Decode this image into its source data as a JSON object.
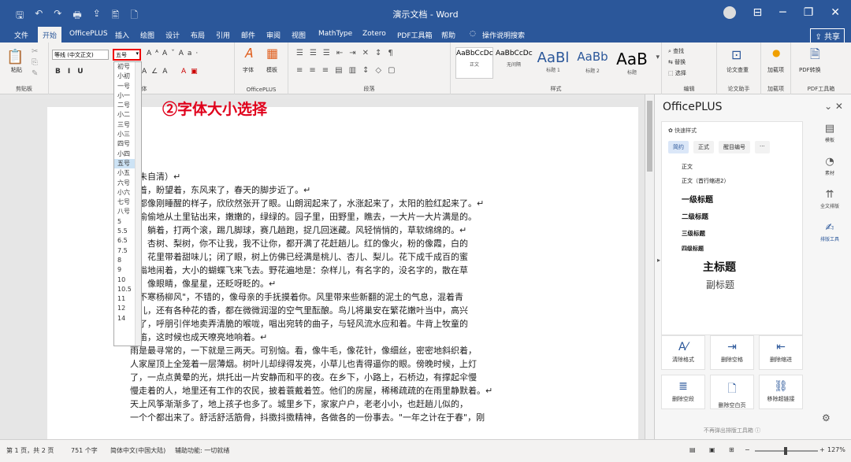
{
  "title": "演示文档 - Word",
  "qat": [
    "🖫",
    "↶",
    "↷",
    "🖶",
    "⇪",
    "🖺",
    "🗋"
  ],
  "tabs": [
    "文件",
    "开始",
    "OfficePLUS",
    "插入",
    "绘图",
    "设计",
    "布局",
    "引用",
    "邮件",
    "审阅",
    "视图",
    "MathType",
    "Zotero",
    "PDF工具箱",
    "帮助",
    "操作说明搜索"
  ],
  "share": "共享",
  "ribbon": {
    "paste": "粘贴",
    "clipboard": "剪贴板",
    "font_name": "等线 (中文正文)",
    "font_size": "五号",
    "font_group": "字体",
    "officeplus_btns": [
      "字体",
      "模板"
    ],
    "officeplus_group": "OfficePLUS",
    "paragraph_group": "段落",
    "styles": [
      {
        "sample": "AaBbCcDc",
        "label": "正文",
        "size": "9"
      },
      {
        "sample": "AaBbCcDc",
        "label": "无间隔",
        "size": "9"
      },
      {
        "sample": "AaBl",
        "label": "标题 1",
        "size": "18"
      },
      {
        "sample": "AaBb",
        "label": "标题 2",
        "size": "15"
      },
      {
        "sample": "AaB",
        "label": "标题",
        "size": "20"
      }
    ],
    "styles_group": "样式",
    "edit": [
      "查找",
      "替换",
      "选择"
    ],
    "edit_group": "编辑",
    "paper_check": "论文查重",
    "paper_group": "论文助手",
    "addin": "加载项",
    "addin_group": "加载项",
    "pdf": "PDF转换",
    "pdf_group": "PDF工具箱"
  },
  "font_sizes": [
    "初号",
    "小初",
    "一号",
    "小一",
    "二号",
    "小二",
    "三号",
    "小三",
    "四号",
    "小四",
    "五号",
    "小五",
    "六号",
    "小六",
    "七号",
    "八号",
    "5",
    "5.5",
    "6.5",
    "7.5",
    "8",
    "9",
    "10",
    "10.5",
    "11",
    "12",
    "14"
  ],
  "annotation": "②字体大小选择",
  "doc_lines": [
    "（朱自清）↵",
    "望着，盼望着，东风来了，春天的脚步近了。↵",
    "切都像刚睡醒的样子，欣欣然张开了眼。山朗润起来了，水涨起来了，太阳的脸红起来了。↵",
    "草偷偷地从土里钻出来，嫩嫩的，绿绿的。园子里，田野里，瞧去，一大片一大片满是的。",
    "着，躺着，打两个滚，踢几脚球，赛几趟跑，捉几回迷藏。风轻悄悄的，草软绵绵的。↵",
    "树、杏树、梨树，你不让我，我不让你，都开满了花赶趟儿。红的像火，粉的像霞，白的",
    "雪。花里带着甜味儿；闭了眼，树上仿佛已经满是桃儿、杏儿、梨儿。花下成千成百的蜜",
    "嗡嗡地闹着，大小的蝴蝶飞来飞去。野花遍地是：杂样儿，有名字的，没名字的，散在草",
    "里，像眼睛，像星星，还眨呀眨的。↵",
    "面不寒杨柳风\"，不错的，像母亲的手抚摸着你。风里带来些新翻的泥土的气息，混着青",
    "味儿，还有各种花的香，都在微微润湿的空气里酝酿。鸟儿将巢安在繁花嫩叶当中，高兴",
    "来了，呼朋引伴地卖弄清脆的喉咙，唱出宛转的曲子，与轻风流水应和着。牛背上牧童的",
    "短笛，这时候也成天嘹亮地响着。↵",
    "雨是最寻常的，一下就是三两天。可别恼。看，像牛毛，像花针，像细丝，密密地斜织着，",
    "人家屋顶上全笼着一层薄烟。树叶儿却绿得发亮，小草儿也青得逼你的眼。傍晚时候，上灯",
    "了，一点点黄晕的光，烘托出一片安静而和平的夜。在乡下，小路上，石桥边，有撑起伞慢",
    "慢走着的人，地里还有工作的农民，披着蓑戴着笠。他们的房屋，稀稀疏疏的在雨里静默着。↵",
    "天上风筝渐渐多了，地上孩子也多了。城里乡下，家家户户，老老小小，也赶趟儿似的，",
    "一个个都出来了。舒活舒活筋骨，抖擞抖擞精神，各做各的一份事去。\"一年之计在于春\"，刚"
  ],
  "panel": {
    "title": "OfficePLUS",
    "quick": "快速样式",
    "tabs": [
      "简约",
      "正式",
      "醒目编号",
      "···"
    ],
    "style_items": [
      "正文",
      "正文（首行缩进2）",
      "一级标题",
      "二级标题",
      "三级标题",
      "四级标题",
      "主标题",
      "副标题"
    ],
    "rail": [
      {
        "icon": "▤",
        "label": "模板",
        "name": "template"
      },
      {
        "icon": "◔",
        "label": "素材",
        "name": "material"
      },
      {
        "icon": "⇈",
        "label": "全文排版",
        "name": "fulltext"
      },
      {
        "icon": "✍",
        "label": "排版工具",
        "name": "typeset"
      }
    ],
    "tools": [
      {
        "icon": "A⁄",
        "label": "清除格式"
      },
      {
        "icon": "⇥",
        "label": "删除空格"
      },
      {
        "icon": "⇤",
        "label": "删除缩进"
      },
      {
        "icon": "≣",
        "label": "删除空段"
      },
      {
        "icon": "🗋",
        "label": "删除空白页"
      },
      {
        "icon": "⛓",
        "label": "移除超链接"
      }
    ],
    "no_popup": "不再弹出排版工具箱 ⓘ"
  },
  "status": {
    "page": "第 1 页，共 2 页",
    "words": "751 个字",
    "lang": "简体中文(中国大陆)",
    "access": "辅助功能: 一切就绪",
    "zoom": "127%"
  }
}
